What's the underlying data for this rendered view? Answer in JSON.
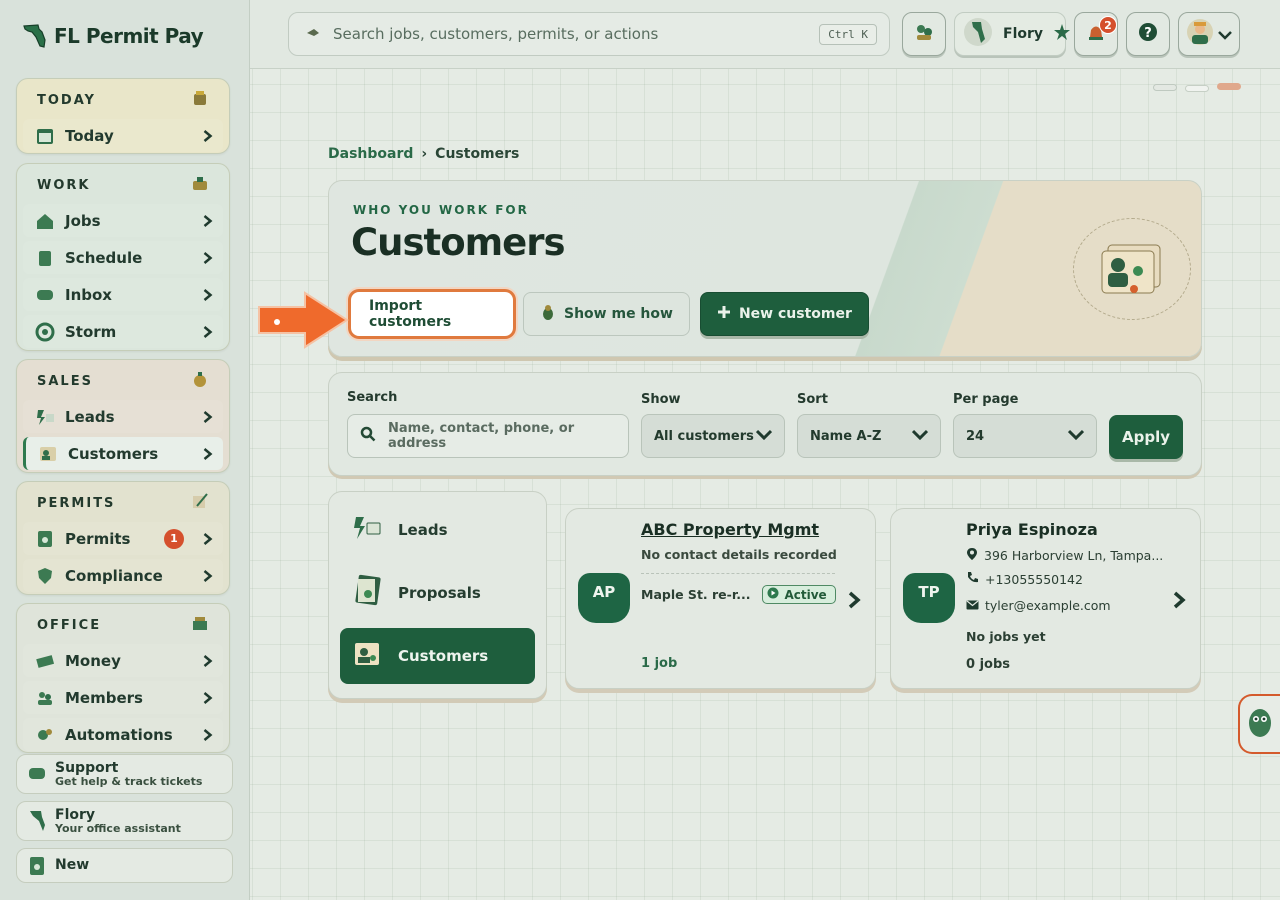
{
  "app": {
    "name": "FL Permit Pay"
  },
  "sidebar": {
    "groups": [
      {
        "title": "TODAY",
        "items": [
          {
            "label": "Today"
          }
        ]
      },
      {
        "title": "WORK",
        "items": [
          {
            "label": "Jobs"
          },
          {
            "label": "Schedule"
          },
          {
            "label": "Inbox"
          },
          {
            "label": "Storm"
          }
        ]
      },
      {
        "title": "SALES",
        "items": [
          {
            "label": "Leads"
          },
          {
            "label": "Customers"
          }
        ]
      },
      {
        "title": "PERMITS",
        "items": [
          {
            "label": "Permits",
            "badge": "1"
          },
          {
            "label": "Compliance"
          }
        ]
      },
      {
        "title": "OFFICE",
        "items": [
          {
            "label": "Money"
          },
          {
            "label": "Members"
          },
          {
            "label": "Automations"
          }
        ]
      }
    ],
    "footer": [
      {
        "title": "Support",
        "subtitle": "Get help & track tickets"
      },
      {
        "title": "Flory",
        "subtitle": "Your office assistant"
      },
      {
        "title": "New"
      }
    ]
  },
  "topbar": {
    "search_placeholder": "Search jobs, customers, permits, or actions",
    "shortcut": "Ctrl K",
    "assistant_name": "Flory",
    "notification_count": "2"
  },
  "breadcrumb": {
    "root": "Dashboard",
    "separator": "›",
    "current": "Customers"
  },
  "hero": {
    "eyebrow": "WHO YOU WORK FOR",
    "title": "Customers",
    "import_label": "Import customers",
    "how_label": "Show me how",
    "new_label": "New customer"
  },
  "filters": {
    "search_label": "Search",
    "search_placeholder": "Name, contact, phone, or address",
    "show_label": "Show",
    "show_value": "All customers",
    "sort_label": "Sort",
    "sort_value": "Name A-Z",
    "perpage_label": "Per page",
    "perpage_value": "24",
    "apply_label": "Apply"
  },
  "tabs": [
    {
      "label": "Leads"
    },
    {
      "label": "Proposals"
    },
    {
      "label": "Customers"
    }
  ],
  "customers": [
    {
      "initials": "AP",
      "name": "ABC Property Mgmt",
      "contact": "No contact details recorded",
      "job_name": "Maple St. re-r...",
      "status": "Active",
      "jobs": "1 job"
    },
    {
      "initials": "TP",
      "name": "Priya Espinoza",
      "address": "396 Harborview Ln, Tampa...",
      "phone": "+13055550142",
      "email": "tyler@example.com",
      "jobs_note": "No jobs yet",
      "jobs": "0 jobs"
    }
  ],
  "colors": {
    "accent": "#1e5e3d",
    "highlight": "#e07a3e",
    "badge": "#d5502d"
  }
}
